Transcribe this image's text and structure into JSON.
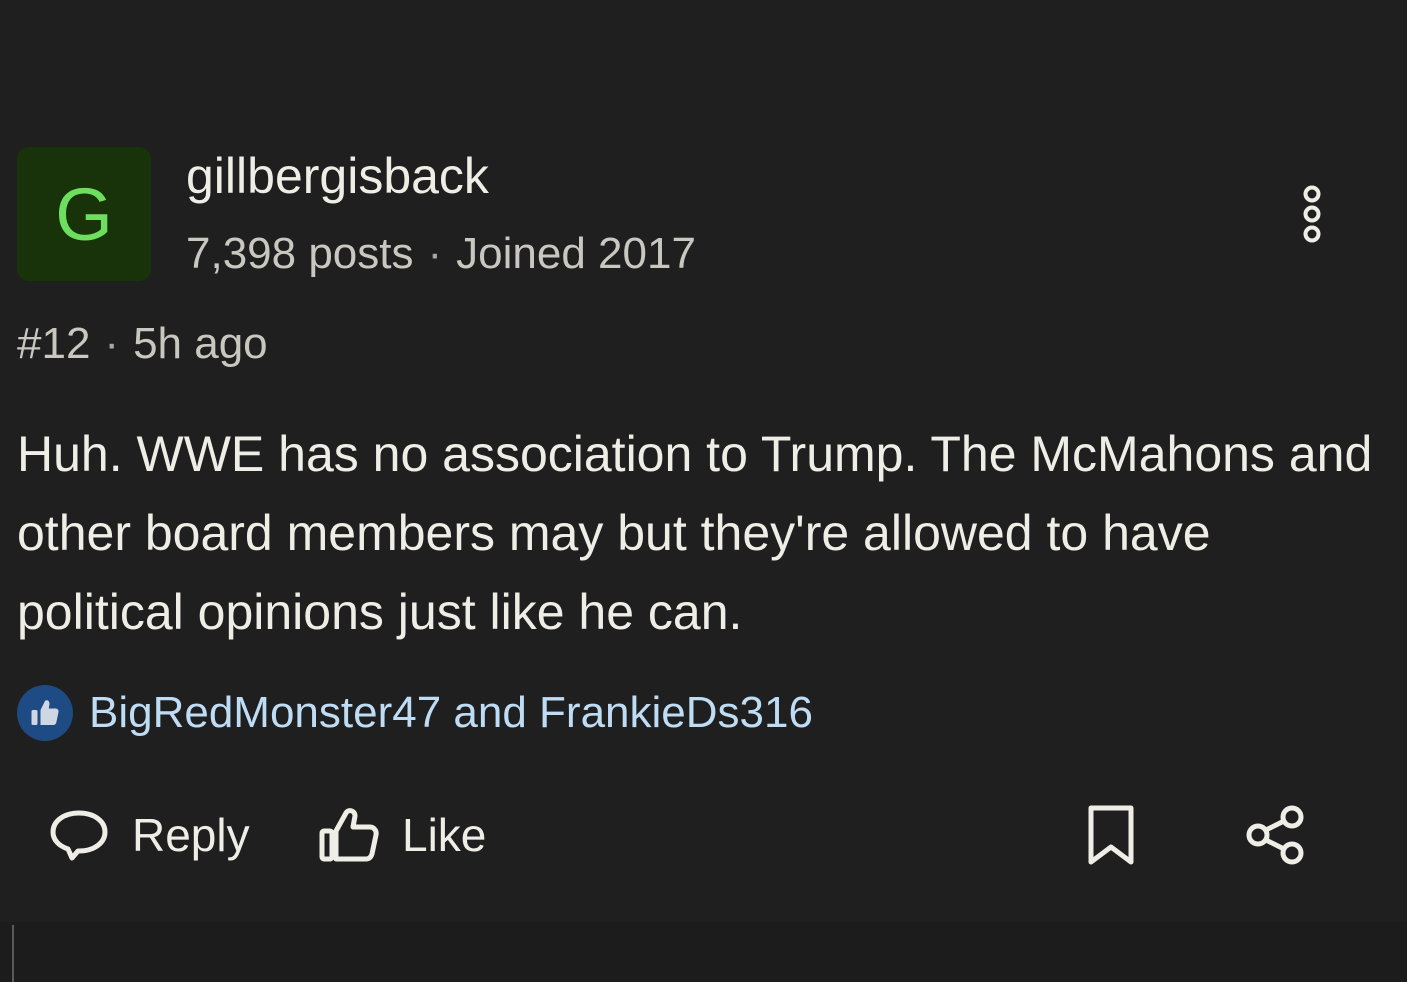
{
  "author": {
    "initial": "G",
    "username": "gillbergisback",
    "posts": "7,398 posts",
    "joined": "Joined 2017"
  },
  "post": {
    "number": "#12",
    "time": "5h ago",
    "body": "Huh. WWE has no association to Trump. The McMahons and other board members may but they're allowed to have political opinions just like he can."
  },
  "reactions": {
    "likers": "BigRedMonster47 and FrankieDs316"
  },
  "actions": {
    "reply_label": "Reply",
    "like_label": "Like"
  },
  "icons": {
    "more": "more-vertical-icon",
    "like_badge": "thumbs-up-icon",
    "reply": "speech-bubble-icon",
    "like": "thumbs-up-outline-icon",
    "bookmark": "bookmark-icon",
    "share": "share-icon"
  },
  "colors": {
    "background": "#1f1f1f",
    "avatar_bg": "#183309",
    "avatar_fg": "#6dde5e",
    "link": "#bfdcf5",
    "like_badge": "#1e4b83"
  }
}
